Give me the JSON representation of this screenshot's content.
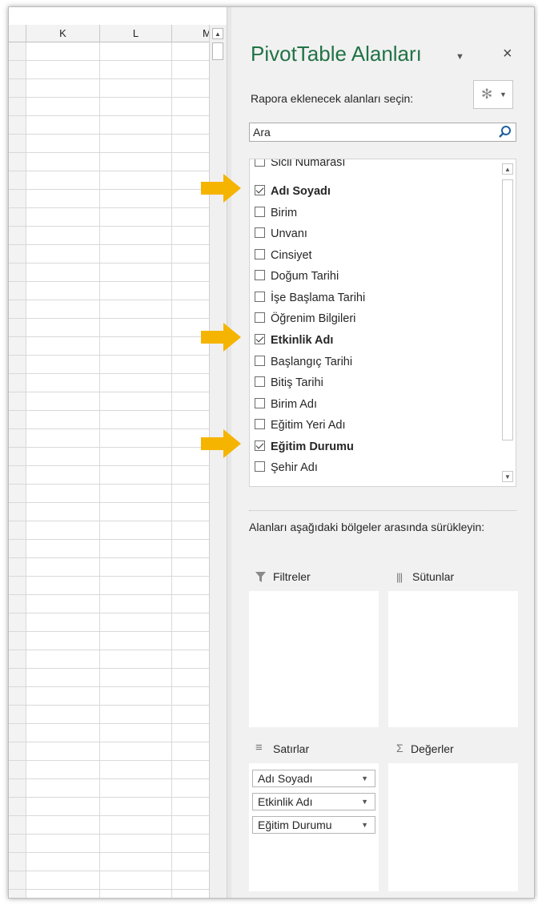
{
  "sheet": {
    "columns": [
      "K",
      "L",
      "M"
    ],
    "scroll_up_icon": "triangle-up"
  },
  "pane": {
    "title": "PivotTable Alanları",
    "title_dropdown_icon": "triangle-down",
    "close_icon": "×",
    "choose_label": "Rapora eklenecek alanları seçin:",
    "gear_icon": "✻",
    "gear_dropdown_icon": "▾",
    "search_placeholder": "Ara",
    "fields": [
      {
        "label": "Sicil Numarası",
        "checked": false
      },
      {
        "label": "Adı Soyadı",
        "checked": true
      },
      {
        "label": "Birim",
        "checked": false
      },
      {
        "label": "Unvanı",
        "checked": false
      },
      {
        "label": "Cinsiyet",
        "checked": false
      },
      {
        "label": "Doğum Tarihi",
        "checked": false
      },
      {
        "label": "İşe Başlama Tarihi",
        "checked": false
      },
      {
        "label": "Öğrenim Bilgileri",
        "checked": false
      },
      {
        "label": "Etkinlik Adı",
        "checked": true
      },
      {
        "label": "Başlangıç Tarihi",
        "checked": false
      },
      {
        "label": "Bitiş Tarihi",
        "checked": false
      },
      {
        "label": "Birim Adı",
        "checked": false
      },
      {
        "label": "Eğitim Yeri Adı",
        "checked": false
      },
      {
        "label": "Eğitim Durumu",
        "checked": true
      },
      {
        "label": "Şehir Adı",
        "checked": false
      }
    ],
    "drag_label": "Alanları aşağıdaki bölgeler arasında sürükleyin:",
    "areas": {
      "filters": "Filtreler",
      "columns": "Sütunlar",
      "rows": "Satırlar",
      "values": "Değerler",
      "filters_icon": "funnel",
      "columns_icon": "|||",
      "rows_icon": "≡",
      "values_icon": "Σ"
    },
    "row_fields": [
      "Adı Soyadı",
      "Etkinlik Adı",
      "Eğitim Durumu"
    ],
    "pill_dropdown_icon": "▾"
  },
  "colors": {
    "title_green": "#217346",
    "arrow_yellow": "#f5b400"
  }
}
